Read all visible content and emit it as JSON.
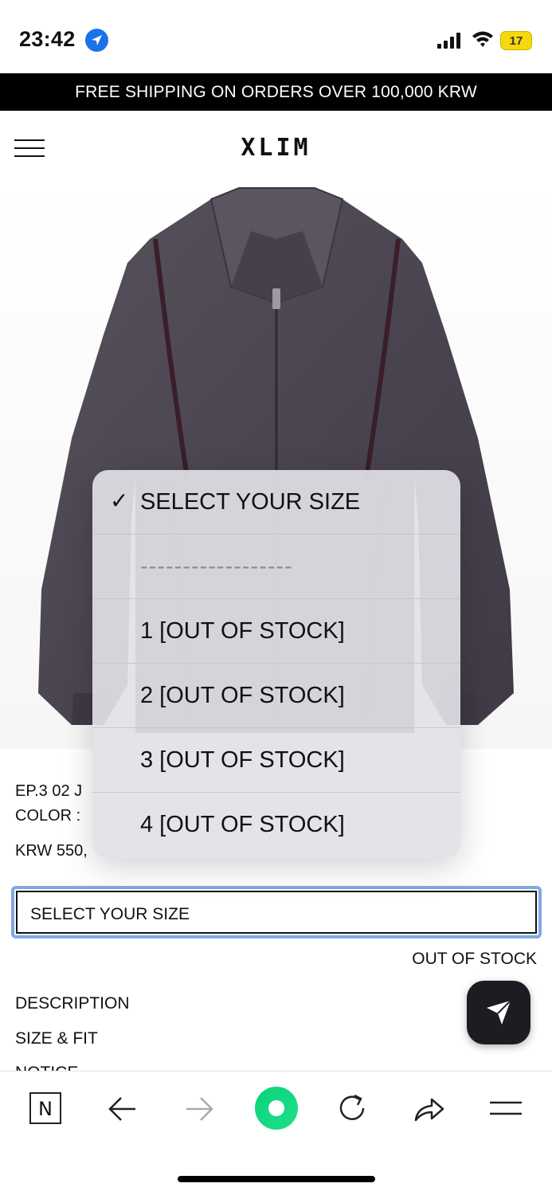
{
  "status_bar": {
    "time": "23:42",
    "battery": "17",
    "icons": [
      "location-arrow-icon",
      "cellular-signal-icon",
      "wifi-icon",
      "battery-charging-icon"
    ]
  },
  "banner": {
    "text": "FREE SHIPPING ON ORDERS OVER 100,000 KRW"
  },
  "header": {
    "brand": "XLIM",
    "menu_icon": "hamburger-menu-icon"
  },
  "product": {
    "name": "EP.3 02 J",
    "color_label": "COLOR :",
    "price": "KRW 550,"
  },
  "size_select": {
    "value": "SELECT YOUR SIZE"
  },
  "stock_status": "OUT OF STOCK",
  "sections": {
    "description": "DESCRIPTION",
    "size_fit": "SIZE & FIT",
    "notice": "NOTICE"
  },
  "dropdown": {
    "options": [
      {
        "label": "SELECT YOUR SIZE",
        "selected": true
      },
      {
        "label": "------------------",
        "selected": false
      },
      {
        "label": "1 [OUT OF STOCK]",
        "selected": false
      },
      {
        "label": "2 [OUT OF STOCK]",
        "selected": false
      },
      {
        "label": "3 [OUT OF STOCK]",
        "selected": false
      },
      {
        "label": "4 [OUT OF STOCK]",
        "selected": false
      }
    ],
    "check_glyph": "✓"
  },
  "toolbar": {
    "n_label": "N",
    "icons": [
      "n-app-icon",
      "back-arrow-icon",
      "forward-arrow-icon",
      "home-icon",
      "reload-icon",
      "share-icon",
      "menu-icon"
    ]
  },
  "colors": {
    "accent_green": "#1ed760",
    "select_focus": "#7fa8e6",
    "fab_dark": "#1c1d22",
    "jacket": "#4b4650"
  }
}
